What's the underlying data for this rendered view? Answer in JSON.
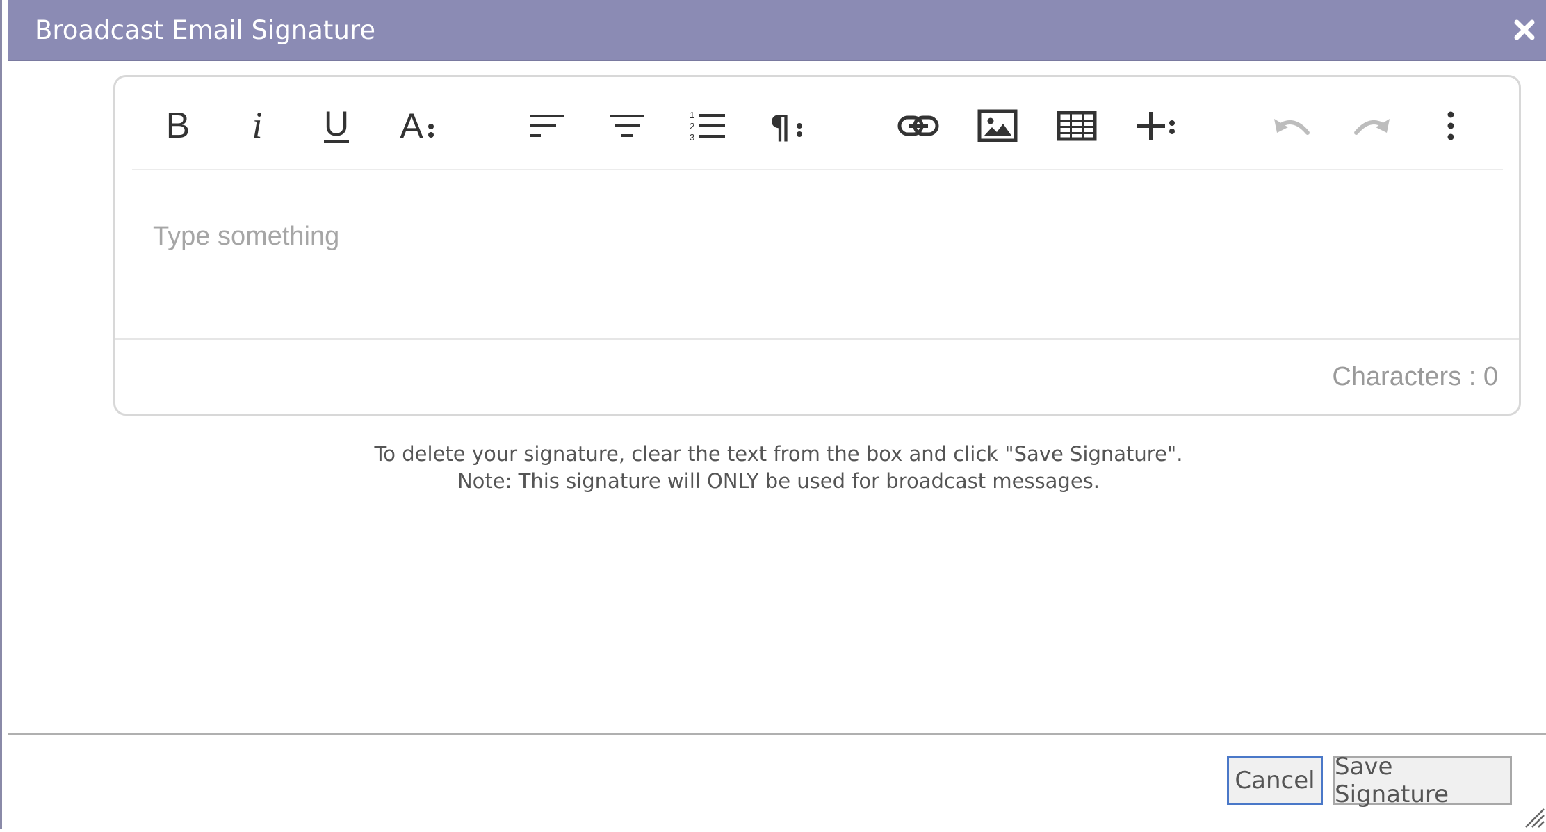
{
  "dialog": {
    "title": "Broadcast Email Signature"
  },
  "toolbar": {
    "buttons": [
      {
        "name": "bold",
        "icon": "bold-icon"
      },
      {
        "name": "italic",
        "icon": "italic-icon"
      },
      {
        "name": "underline",
        "icon": "underline-icon"
      },
      {
        "name": "font-size",
        "icon": "font-size-icon"
      },
      {
        "name": "align-left",
        "icon": "align-left-icon"
      },
      {
        "name": "align-center",
        "icon": "align-center-icon"
      },
      {
        "name": "ordered-list",
        "icon": "ordered-list-icon"
      },
      {
        "name": "paragraph-format",
        "icon": "paragraph-icon"
      },
      {
        "name": "insert-link",
        "icon": "link-icon"
      },
      {
        "name": "insert-image",
        "icon": "image-icon"
      },
      {
        "name": "insert-table",
        "icon": "table-icon"
      },
      {
        "name": "insert-more",
        "icon": "plus-icon"
      },
      {
        "name": "undo",
        "icon": "undo-icon"
      },
      {
        "name": "redo",
        "icon": "redo-icon"
      },
      {
        "name": "more-options",
        "icon": "vertical-dots-icon"
      }
    ]
  },
  "editor": {
    "placeholder": "Type something",
    "value": "",
    "char_count": "Characters : 0"
  },
  "info": {
    "line1": "To delete your signature, clear the text from the box and click \"Save Signature\".",
    "line2": "Note: This signature will ONLY be used for broadcast messages."
  },
  "buttons": {
    "cancel_label": "Cancel",
    "save_label": "Save Signature"
  },
  "colors": {
    "titlebar": "#8b8bb4",
    "icon": "#333333",
    "icon_disabled": "#bdbdbd",
    "focus_border": "#4a78c8"
  }
}
